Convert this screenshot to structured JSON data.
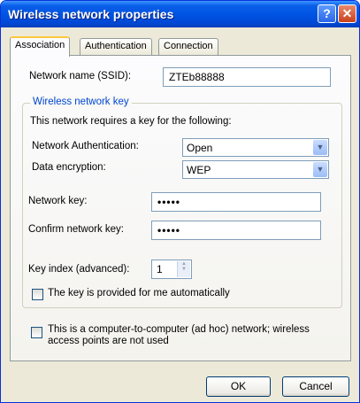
{
  "window": {
    "title": "Wireless network properties"
  },
  "titlebar": {
    "help_label": "?",
    "close_label": "✕"
  },
  "tabs": [
    {
      "label": "Association"
    },
    {
      "label": "Authentication"
    },
    {
      "label": "Connection"
    }
  ],
  "association": {
    "ssid_label": "Network name (SSID):",
    "ssid_value": "ZTEb88888",
    "group_title": "Wireless network key",
    "group_desc": "This network requires a key for the following:",
    "auth_label": "Network Authentication:",
    "auth_value": "Open",
    "enc_label": "Data encryption:",
    "enc_value": "WEP",
    "key_label": "Network key:",
    "key_value": "•••••",
    "confirm_label": "Confirm network key:",
    "confirm_value": "•••••",
    "index_label": "Key index (advanced):",
    "index_value": "1",
    "auto_key_label": "The key is provided for me automatically",
    "auto_key_checked": false,
    "adhoc_label_line1": "This is a computer-to-computer (ad hoc) network; wireless",
    "adhoc_label_line2": "access points are not used",
    "adhoc_checked": false
  },
  "buttons": {
    "ok": "OK",
    "cancel": "Cancel"
  },
  "icons": {
    "combo_arrow": "chevron-down-icon",
    "spin": "spin-arrows-icon"
  },
  "colors": {
    "titlebar": "#0054e3",
    "group_title": "#0046d5",
    "tab_highlight": "#ffc83d"
  }
}
